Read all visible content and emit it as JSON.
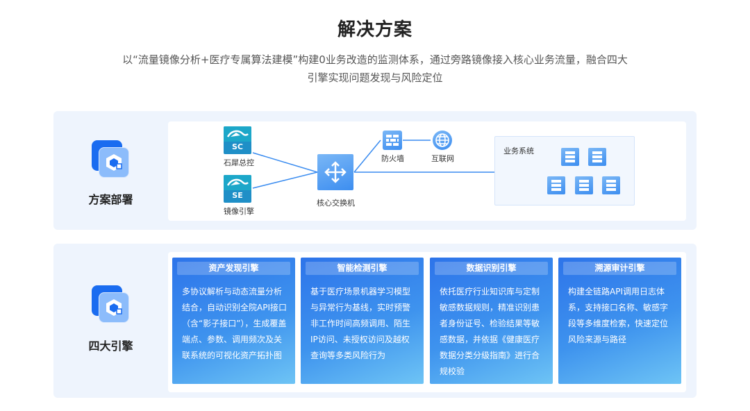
{
  "title": "解决方案",
  "subtitle_line1": "以“流量镜像分析+医疗专属算法建模”构建0业务改造的监测体系，通过旁路镜像接入核心业务流量，融合四大",
  "subtitle_line2": "引擎实现问题发现与风险定位",
  "deploy": {
    "label": "方案部署",
    "nodes": {
      "sc": {
        "code": "SC",
        "label": "石犀总控"
      },
      "se": {
        "code": "SE",
        "label": "镜像引擎"
      },
      "core_switch": {
        "label": "核心交换机"
      },
      "firewall": {
        "label": "防火墙"
      },
      "internet": {
        "label": "互联网"
      },
      "business": {
        "label": "业务系统"
      }
    }
  },
  "engines": {
    "label": "四大引擎",
    "cards": [
      {
        "title": "资产发现引擎",
        "text": "多协议解析与动态流量分析结合，自动识别全院API接口（含“影子接口”），生成覆盖端点、参数、调用频次及关联系统的可视化资产拓扑图"
      },
      {
        "title": "智能检测引擎",
        "text": "基于医疗场景机器学习模型与异常行为基线，实时预警非工作时间高频调用、陌生IP访问、未授权访问及越权查询等多类风险行为"
      },
      {
        "title": "数据识别引擎",
        "text": "依托医疗行业知识库与定制敏感数据规则，精准识别患者身份证号、检验结果等敏感数据，并依据《健康医疗数据分类分级指南》进行合规校验"
      },
      {
        "title": "溯源审计引擎",
        "text": "构建全链路API调用日志体系，支持接口名称、敏感字段等多维度检索，快速定位风险来源与路径"
      }
    ]
  },
  "colors": {
    "accent": "#1a6cf0",
    "card_start": "#2d74ea",
    "card_end": "#6ec4f5",
    "panel_bg": "#eef4fd"
  }
}
